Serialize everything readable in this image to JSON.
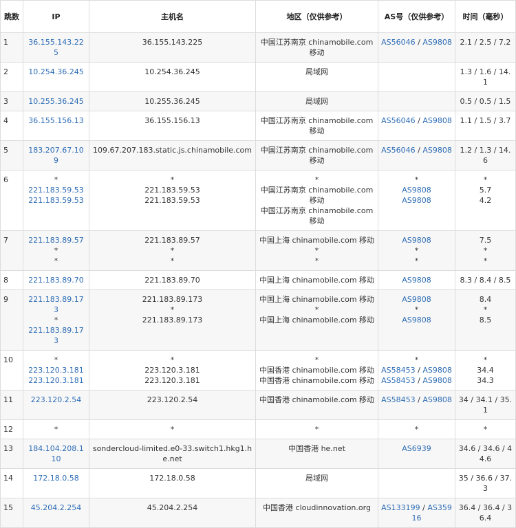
{
  "headers": {
    "hop": "跳数",
    "ip": "IP",
    "host": "主机名",
    "area": "地区（仅供参考）",
    "as": "AS号（仅供参考）",
    "time": "时间（毫秒）"
  },
  "rows": [
    {
      "hop": "1",
      "ip": [
        "36.155.143.225"
      ],
      "host": [
        "36.155.143.225"
      ],
      "area": [
        "中国江苏南京 chinamobile.com 移动"
      ],
      "as": [
        [
          "AS56046",
          "AS9808"
        ]
      ],
      "time": [
        "2.1 / 2.5 / 7.2"
      ]
    },
    {
      "hop": "2",
      "ip": [
        "10.254.36.245"
      ],
      "host": [
        "10.254.36.245"
      ],
      "area": [
        "局域网"
      ],
      "as": [
        []
      ],
      "time": [
        "1.3 / 1.6 / 14.1"
      ]
    },
    {
      "hop": "3",
      "ip": [
        "10.255.36.245"
      ],
      "host": [
        "10.255.36.245"
      ],
      "area": [
        "局域网"
      ],
      "as": [
        []
      ],
      "time": [
        "0.5 / 0.5 / 1.5"
      ]
    },
    {
      "hop": "4",
      "ip": [
        "36.155.156.13"
      ],
      "host": [
        "36.155.156.13"
      ],
      "area": [
        "中国江苏南京 chinamobile.com 移动"
      ],
      "as": [
        [
          "AS56046",
          "AS9808"
        ]
      ],
      "time": [
        "1.1 / 1.5 / 3.7"
      ]
    },
    {
      "hop": "5",
      "ip": [
        "183.207.67.109"
      ],
      "host": [
        "109.67.207.183.static.js.chinamobile.com"
      ],
      "area": [
        "中国江苏南京 chinamobile.com 移动"
      ],
      "as": [
        [
          "AS56046",
          "AS9808"
        ]
      ],
      "time": [
        "1.2 / 1.3 / 14.6"
      ]
    },
    {
      "hop": "6",
      "ip": [
        "*",
        "221.183.59.53",
        "221.183.59.53"
      ],
      "host": [
        "*",
        "221.183.59.53",
        "221.183.59.53"
      ],
      "area": [
        "*",
        "中国江苏南京 chinamobile.com 移动",
        "中国江苏南京 chinamobile.com 移动"
      ],
      "as": [
        [
          "*"
        ],
        [
          "AS9808"
        ],
        [
          "AS9808"
        ]
      ],
      "time": [
        "*",
        "5.7",
        "4.2"
      ]
    },
    {
      "hop": "7",
      "ip": [
        "221.183.89.57",
        "*",
        "*"
      ],
      "host": [
        "221.183.89.57",
        "*",
        "*"
      ],
      "area": [
        "中国上海 chinamobile.com 移动",
        "*",
        "*"
      ],
      "as": [
        [
          "AS9808"
        ],
        [
          "*"
        ],
        [
          "*"
        ]
      ],
      "time": [
        "7.5",
        "*",
        "*"
      ]
    },
    {
      "hop": "8",
      "ip": [
        "221.183.89.70"
      ],
      "host": [
        "221.183.89.70"
      ],
      "area": [
        "中国上海 chinamobile.com 移动"
      ],
      "as": [
        [
          "AS9808"
        ]
      ],
      "time": [
        "8.3 / 8.4 / 8.5"
      ]
    },
    {
      "hop": "9",
      "ip": [
        "221.183.89.173",
        "*",
        "221.183.89.173"
      ],
      "host": [
        "221.183.89.173",
        "*",
        "221.183.89.173"
      ],
      "area": [
        "中国上海 chinamobile.com 移动",
        "*",
        "中国上海 chinamobile.com 移动"
      ],
      "as": [
        [
          "AS9808"
        ],
        [
          "*"
        ],
        [
          "AS9808"
        ]
      ],
      "time": [
        "8.4",
        "*",
        "8.5"
      ]
    },
    {
      "hop": "10",
      "ip": [
        "*",
        "223.120.3.181",
        "223.120.3.181"
      ],
      "host": [
        "*",
        "223.120.3.181",
        "223.120.3.181"
      ],
      "area": [
        "*",
        "中国香港 chinamobile.com 移动",
        "中国香港 chinamobile.com 移动"
      ],
      "as": [
        [
          "*"
        ],
        [
          "AS58453",
          "AS9808"
        ],
        [
          "AS58453",
          "AS9808"
        ]
      ],
      "time": [
        "*",
        "34.4",
        "34.3"
      ]
    },
    {
      "hop": "11",
      "ip": [
        "223.120.2.54"
      ],
      "host": [
        "223.120.2.54"
      ],
      "area": [
        "中国香港 chinamobile.com 移动"
      ],
      "as": [
        [
          "AS58453",
          "AS9808"
        ]
      ],
      "time": [
        "34 / 34.1 / 35.1"
      ]
    },
    {
      "hop": "12",
      "ip": [
        "*"
      ],
      "host": [
        "*"
      ],
      "area": [
        "*"
      ],
      "as": [
        [
          "*"
        ]
      ],
      "time": [
        "*"
      ]
    },
    {
      "hop": "13",
      "ip": [
        "184.104.208.110"
      ],
      "host": [
        "sondercloud-limited.e0-33.switch1.hkg1.he.net"
      ],
      "area": [
        "中国香港 he.net"
      ],
      "as": [
        [
          "AS6939"
        ]
      ],
      "time": [
        "34.6 / 34.6 / 44.6"
      ]
    },
    {
      "hop": "14",
      "ip": [
        "172.18.0.58"
      ],
      "host": [
        "172.18.0.58"
      ],
      "area": [
        "局域网"
      ],
      "as": [
        []
      ],
      "time": [
        "35 / 36.6 / 37.3"
      ]
    },
    {
      "hop": "15",
      "ip": [
        "45.204.2.254"
      ],
      "host": [
        "45.204.2.254"
      ],
      "area": [
        "中国香港 cloudinnovation.org"
      ],
      "as": [
        [
          "AS133199",
          "AS35916"
        ]
      ],
      "time": [
        "36.4 / 36.4 / 36.4"
      ]
    }
  ]
}
